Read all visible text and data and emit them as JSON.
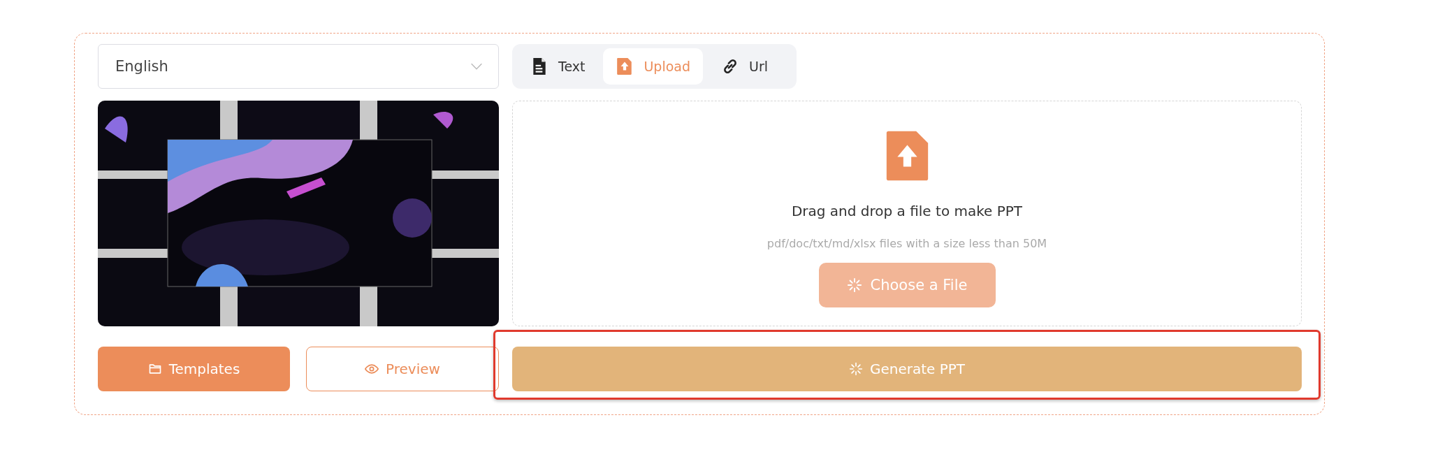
{
  "language_select": {
    "value": "English"
  },
  "source_tabs": [
    {
      "label": "Text",
      "selected": false
    },
    {
      "label": "Upload",
      "selected": true
    },
    {
      "label": "Url",
      "selected": false
    }
  ],
  "upload_area": {
    "title": "Drag and drop a file to make PPT",
    "hint": "pdf/doc/txt/md/xlsx files with a size less than 50M",
    "button": {
      "label": "Choose a File",
      "loading": true
    }
  },
  "buttons": [
    {
      "kind": "primary",
      "label": "Templates"
    },
    {
      "kind": "outline",
      "label": "Preview"
    }
  ],
  "generate_button": {
    "label": "Generate PPT",
    "loading": true,
    "disabled": true,
    "highlighted": true
  }
}
